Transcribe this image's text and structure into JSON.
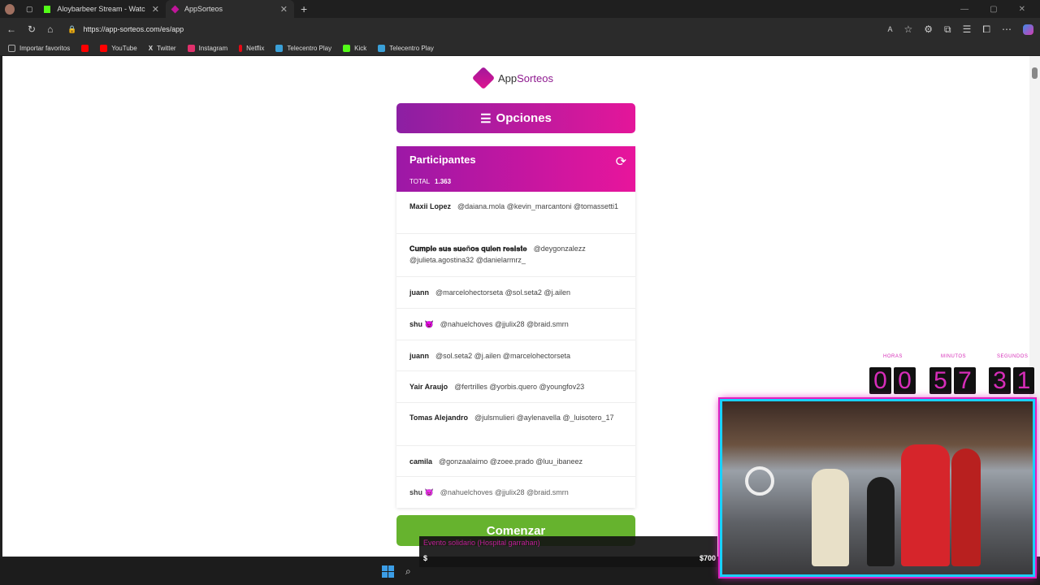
{
  "browser": {
    "tabs": [
      {
        "title": "Aloybarbeer Stream - Watch Live",
        "color": "#53fc18"
      },
      {
        "title": "AppSorteos",
        "color": "#c0169a"
      }
    ],
    "url": "https://app-sorteos.com/es/app",
    "bookmarks": [
      {
        "label": "Importar favoritos",
        "color": "#888888"
      },
      {
        "label": "YouTube",
        "color": "#ff0000"
      },
      {
        "label": "Twitter",
        "color": "#ffffff"
      },
      {
        "label": "Instagram",
        "color": "#e1306c"
      },
      {
        "label": "Netflix",
        "color": "#e50914"
      },
      {
        "label": "Telecentro Play",
        "color": "#3aa0d8"
      },
      {
        "label": "Kick",
        "color": "#53fc18"
      },
      {
        "label": "Telecentro Play",
        "color": "#3aa0d8"
      }
    ]
  },
  "app": {
    "logo_app": "App",
    "logo_sorteos": "Sorteos",
    "options_label": "Opciones",
    "participants_title": "Participantes",
    "total_label": "TOTAL",
    "total_value": "1.363",
    "participants": [
      {
        "name": "Maxii Lopez",
        "mentions": "@daiana.mola @kevin_marcantoni @tomassetti1"
      },
      {
        "name": "𝐂𝐮𝐦𝐩𝐥𝐞 𝐬𝐮𝐬 𝐬𝐮𝐞ñ𝐨𝐬 𝐪𝐮𝐢𝐞𝐧 𝐫𝐞𝐬𝐢𝐬𝐭𝐞",
        "mentions": "@deygonzalezz @julieta.agostina32 @danielarmrz_"
      },
      {
        "name": "juann",
        "mentions": "@marcelohectorseta @sol.seta2 @j.ailen"
      },
      {
        "name": "shu 😈",
        "mentions": "@nahuelchoves @jjulix28 @braid.smrn"
      },
      {
        "name": "juann",
        "mentions": "@sol.seta2 @j.ailen @marcelohectorseta"
      },
      {
        "name": "Yair Araujo",
        "mentions": "@fertrilles @yorbis.quero @youngfov23"
      },
      {
        "name": "Tomas Alejandro",
        "mentions": "@julsmulieri @aylenavella @_luisotero_17"
      },
      {
        "name": "camila",
        "mentions": "@gonzaalaimo @zoee.prado @luu_ibaneez"
      },
      {
        "name": "shu 😈",
        "mentions": "@nahuelchoves @jjulix28 @braid.smrn"
      }
    ],
    "start_label": "Comenzar"
  },
  "overlay": {
    "donation_title": "Evento solidario (Hospital garrahan)",
    "currency": "$",
    "amount": "$700",
    "timer_labels": {
      "hours": "HORAS",
      "minutes": "MINUTOS",
      "seconds": "SEGUNDOS"
    },
    "timer_digits": [
      "0",
      "0",
      "5",
      "7",
      "3",
      "1"
    ]
  }
}
